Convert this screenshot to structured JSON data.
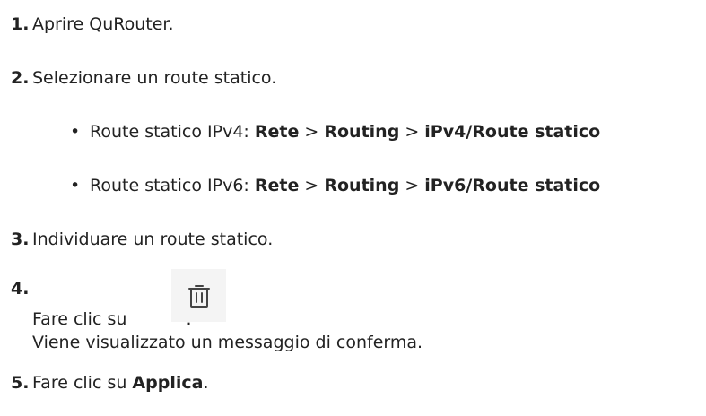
{
  "steps": [
    {
      "num": "1.",
      "text": "Aprire QuRouter."
    },
    {
      "num": "2.",
      "text": "Selezionare un route statico."
    },
    {
      "num": "3.",
      "text": "Individuare un route statico."
    },
    {
      "num": "4.",
      "line1": "Fare clic su",
      "line1_end": ".",
      "line2": "Viene visualizzato un messaggio di conferma."
    },
    {
      "num": "5.",
      "prefix": "Fare clic su ",
      "bold": "Applica",
      "suffix": "."
    }
  ],
  "substeps": [
    {
      "bullet": "•",
      "label": "Route statico IPv4: ",
      "path": [
        "Rete",
        "Routing",
        "iPv4/Route statico"
      ],
      "sep": " > "
    },
    {
      "bullet": "•",
      "label": "Route statico IPv6: ",
      "path": [
        "Rete",
        "Routing",
        "iPv6/Route statico"
      ],
      "sep": " > "
    }
  ],
  "icons": {
    "delete": "trash-icon"
  }
}
